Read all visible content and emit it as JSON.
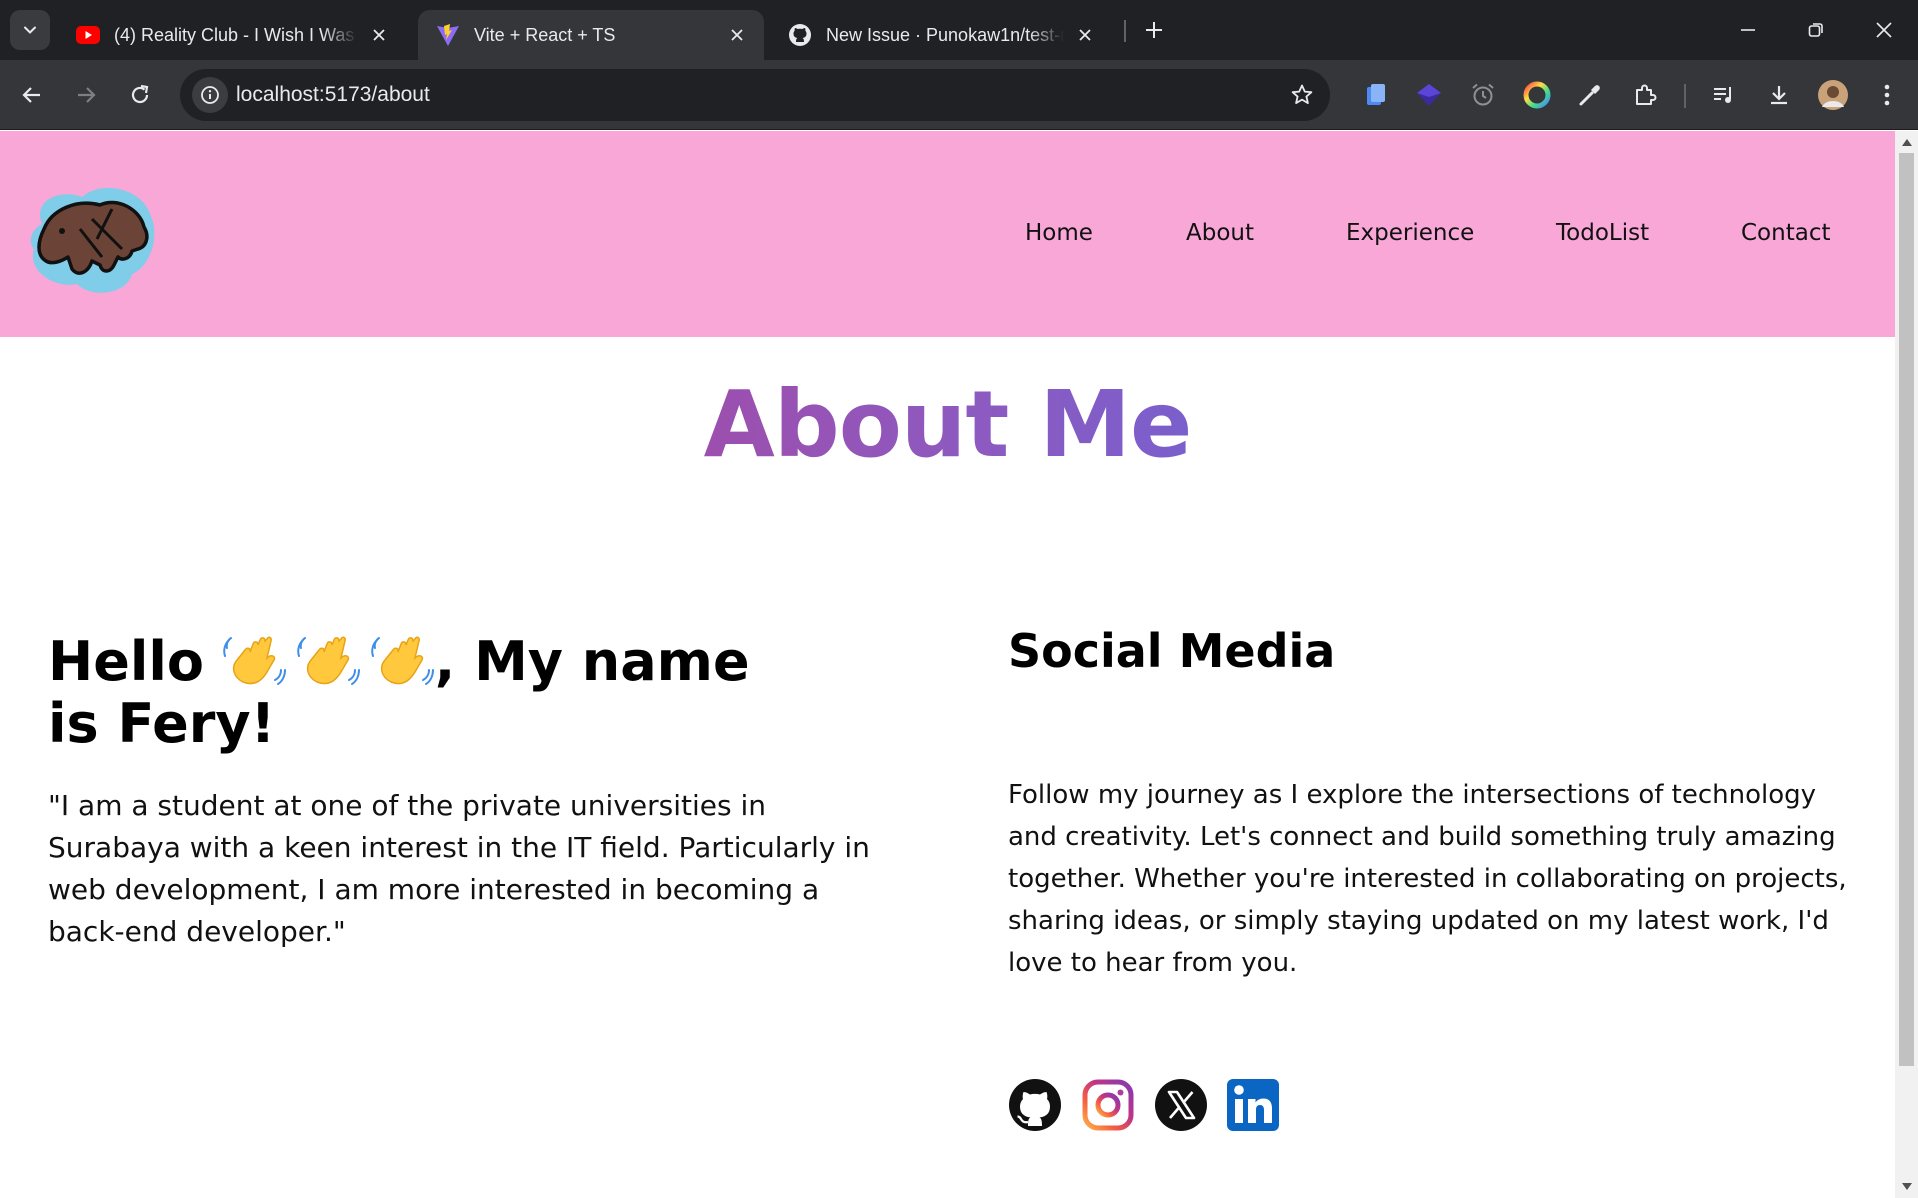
{
  "browser": {
    "tabs": [
      {
        "title": "(4) Reality Club - I Wish I Was Yo",
        "favicon": "youtube-icon",
        "active": false
      },
      {
        "title": "Vite + React + TS",
        "favicon": "vite-icon",
        "active": true
      },
      {
        "title": "New Issue · Punokaw1n/test-re",
        "favicon": "github-icon",
        "active": false
      }
    ],
    "url": "localhost:5173/about"
  },
  "site": {
    "logo": "elephant-logo",
    "nav": [
      "Home",
      "About",
      "Experience",
      "TodoList",
      "Contact"
    ],
    "header_color": "#f8a7d7"
  },
  "about": {
    "title": "About Me",
    "greeting_prefix": "Hello",
    "greeting_suffix": ", My name",
    "greeting_line2": "is Fery!",
    "bio": "\"I am a student at one of the private universities in Surabaya with a keen interest in the IT field. Particularly in web development, I am more interested in becoming a back-end developer.\""
  },
  "social": {
    "title": "Social Media",
    "text": "Follow my journey as I explore the intersections of technology and creativity. Let's connect and build something truly amazing together. Whether you're interested in collaborating on projects, sharing ideas, or simply staying updated on my latest work, I'd love to hear from you.",
    "icons": [
      "github-icon",
      "instagram-icon",
      "x-icon",
      "linkedin-icon"
    ]
  },
  "colors": {
    "title_gradient_start": "#9c4fae",
    "title_gradient_end": "#7a5fcc"
  }
}
